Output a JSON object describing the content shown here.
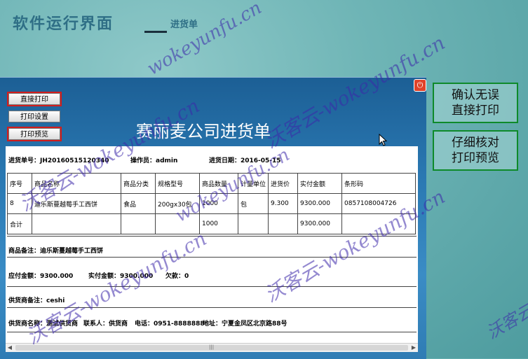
{
  "page": {
    "title": "软件运行界面",
    "subtitle": "进货单"
  },
  "window": {
    "close_icon": "power-icon",
    "buttons": {
      "direct_print": "直接打印",
      "print_settings": "打印设置",
      "print_preview": "打印预览"
    },
    "doc_title": "赛丽麦公司进货单"
  },
  "document": {
    "order_no": "进货单号：JH20160515120340",
    "operator": "操作员：admin",
    "date": "进货日期：2016-05-15",
    "table": {
      "headers": [
        "序号",
        "商品名称",
        "商品分类",
        "规格型号",
        "商品数量",
        "计量单位",
        "进货价",
        "实付金额",
        "条形码"
      ],
      "rows": [
        [
          "8",
          "迪乐斯蔓越莓手工西饼",
          "食品",
          "200gx30包",
          "1000",
          "包",
          "9.300",
          "9300.000",
          "0857108004726"
        ],
        [
          "合计",
          "",
          "",
          "",
          "1000",
          "",
          "",
          "9300.000",
          ""
        ]
      ]
    },
    "product_note": "商品备注：迪乐斯蔓越莓手工西饼",
    "payable": "应付金额：9300.000",
    "paid": "实付金额：9300.000",
    "debt": "欠款：0",
    "supplier_note": "供货商备注：ceshi",
    "supplier_name": "供货商名称：测试供货商",
    "contact": "联系人：供货商",
    "phone": "电话：0951-8888888",
    "address": "地址：宁夏金凤区北京路88号"
  },
  "side": {
    "confirm_line1": "确认无误",
    "confirm_line2": "直接打印",
    "check_line1": "仔细核对",
    "check_line2": "打印预览"
  },
  "watermark": {
    "text1": "沃客云-wokeyunfu.cn",
    "text2": "wokeyunfu.cn",
    "text3": "沃客云"
  },
  "colors": {
    "highlight_border": "#d21d1d",
    "side_border": "#0e8a2a",
    "window_blue": "#2a78b2"
  }
}
